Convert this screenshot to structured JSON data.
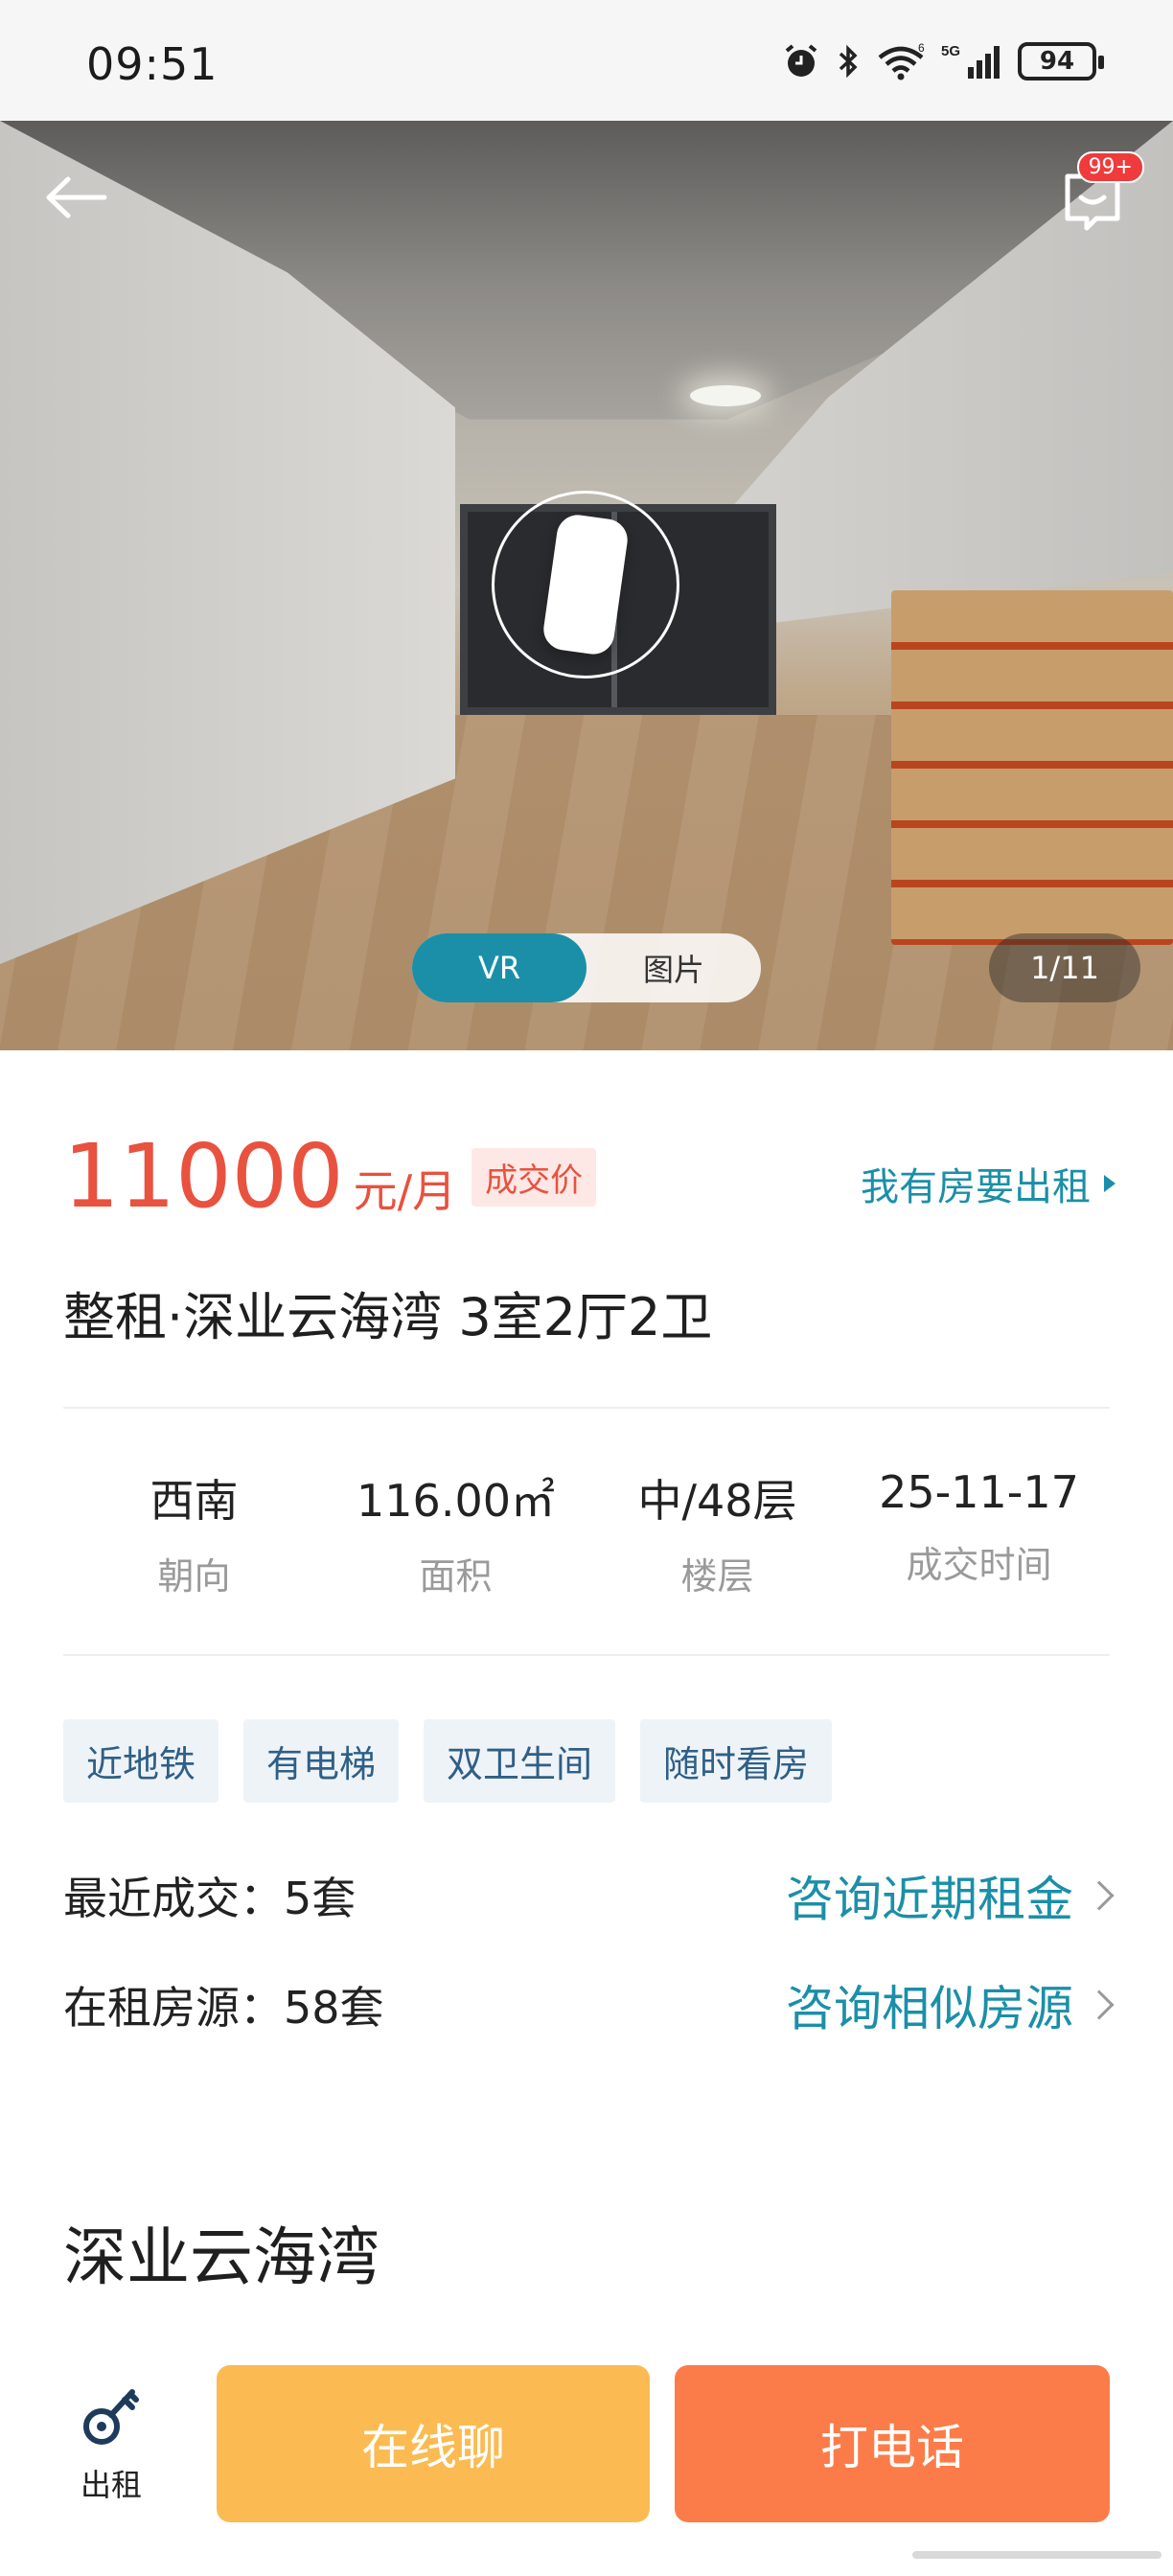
{
  "status_bar": {
    "time": "09:51",
    "battery": "94",
    "network_label": "5G",
    "wifi_label": "6"
  },
  "hero": {
    "tabs": [
      {
        "label": "VR",
        "active": true
      },
      {
        "label": "图片",
        "active": false
      }
    ],
    "counter": "1/11",
    "message_badge": "99+"
  },
  "listing": {
    "price": "11000",
    "price_unit": "元/月",
    "price_tag": "成交价",
    "rent_link": "我有房要出租",
    "title": "整租·深业云海湾 3室2厅2卫",
    "stats": [
      {
        "value": "西南",
        "label": "朝向"
      },
      {
        "value": "116.00㎡",
        "label": "面积"
      },
      {
        "value": "中/48层",
        "label": "楼层"
      },
      {
        "value": "25-11-17",
        "label": "成交时间"
      }
    ],
    "tags": [
      "近地铁",
      "有电梯",
      "双卫生间",
      "随时看房"
    ],
    "recent_deals": {
      "label": "最近成交：5套",
      "action": "咨询近期租金"
    },
    "renting": {
      "label": "在租房源：58套",
      "action": "咨询相似房源"
    },
    "community_name": "深业云海湾"
  },
  "bottom_bar": {
    "rent_label": "出租",
    "chat_label": "在线聊",
    "call_label": "打电话"
  },
  "colors": {
    "accent_teal": "#1b8fa8",
    "price_red": "#e8523f",
    "chat_orange": "#fbbb52",
    "call_orange": "#fb7c49"
  }
}
